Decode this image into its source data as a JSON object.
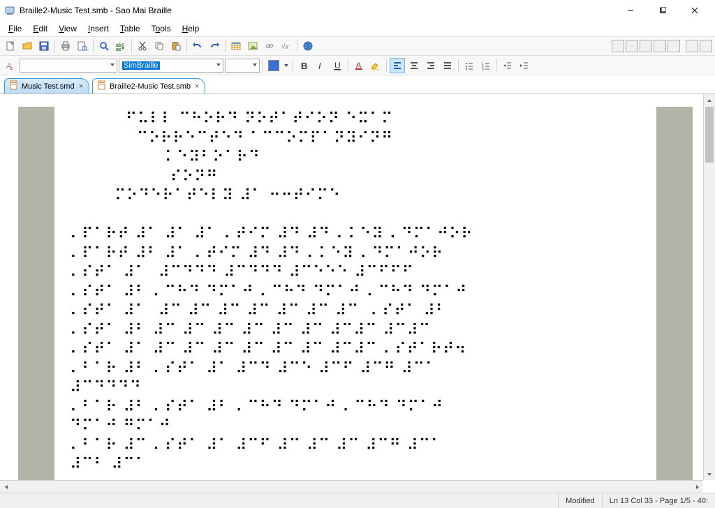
{
  "window": {
    "title": "Braille2-Music Test.smb - Sao Mai Braille"
  },
  "menu": {
    "file": "File",
    "edit": "Edit",
    "view": "View",
    "insert": "Insert",
    "table": "Table",
    "tools": "Tools",
    "help": "Help"
  },
  "toolbar": {
    "style_combo": "",
    "font_combo": "SimBraille",
    "size_combo": "",
    "color_swatch": "#3a6fd8"
  },
  "tabs": {
    "inactive": {
      "label": "Music Test.smd"
    },
    "active": {
      "label": "Braille2-Music Test.smb"
    }
  },
  "document": {
    "lines": [
      "          ⠋⠥⠇⠇ ⠉⠓⠕⠗⠙ ⠝⠕⠞⠁⠞⠊⠕⠝ ⠑⠭⠁⠍",
      "            ⠉⠕⠗⠗⠑⠉⠞⠑⠙ ⠁⠉⠉⠕⠍⠏⠁⠝⠽⠊⠝⠛",
      "                 ⠅⠑⠽⠃⠕⠁⠗⠙",
      "                  ⠎⠕⠝⠛",
      "        ⠍⠕⠙⠑⠗⠁⠞⠑⠇⠽ ⠼⠁ ⠒⠒⠞⠊⠍⠑",
      "",
      "⠄⠏⠁⠗⠞ ⠼⠁ ⠼⠁ ⠼⠁ ⠄⠞⠊⠍ ⠼⠙ ⠼⠙ ⠄⠅⠑⠽ ⠄⠙⠍⠁⠚⠕⠗",
      "⠄⠏⠁⠗⠞ ⠼⠃ ⠼⠁ ⠄⠞⠊⠍ ⠼⠙ ⠼⠙ ⠄⠅⠑⠽ ⠄⠙⠍⠁⠚⠕⠗",
      "⠄⠎⠞⠁ ⠼⠁  ⠼⠉⠙⠙⠙ ⠼⠉⠙⠙⠙ ⠼⠉⠑⠑⠑ ⠼⠉⠋⠋⠋",
      "⠄⠎⠞⠁ ⠼⠃ ⠄⠉⠓⠙ ⠙⠍⠁⠚ ⠄⠉⠓⠙ ⠙⠍⠁⠚ ⠄⠉⠓⠙ ⠙⠍⠁⠚",
      "⠄⠎⠞⠁ ⠼⠁  ⠼⠉ ⠼⠉ ⠼⠉ ⠼⠉ ⠼⠉ ⠼⠉ ⠼⠉  ⠄⠎⠞⠁ ⠼⠃",
      "⠄⠎⠞⠁ ⠼⠃ ⠼⠉ ⠼⠉ ⠼⠉ ⠼⠉ ⠼⠉ ⠼⠉ ⠼⠉⠼⠉ ⠼⠉⠼⠉",
      "⠄⠎⠞⠁ ⠼⠁ ⠼⠉ ⠼⠉ ⠼⠉ ⠼⠉ ⠼⠉ ⠼⠉ ⠼⠉⠼⠉ ⠄⠎⠞⠁⠗⠞⠲",
      "⠄⠃⠁⠗ ⠼⠃ ⠄⠎⠞⠁ ⠼⠁ ⠼⠉⠙ ⠼⠉⠑ ⠼⠉⠋ ⠼⠉⠛ ⠼⠉⠁",
      "⠼⠉⠙⠙⠙⠙",
      "⠄⠃⠁⠗ ⠼⠃ ⠄⠎⠞⠁ ⠼⠃ ⠄⠉⠓⠙ ⠙⠍⠁⠚ ⠄⠉⠓⠙ ⠙⠍⠁⠚",
      "⠙⠍⠁⠚ ⠛⠍⠁⠚",
      "⠄⠃⠁⠗ ⠼⠉ ⠄⠎⠞⠁ ⠼⠁ ⠼⠉⠋ ⠼⠉ ⠼⠉ ⠼⠉ ⠼⠉⠛ ⠼⠉⠁",
      "⠼⠉⠃ ⠼⠉⠁"
    ]
  },
  "status": {
    "modified": "Modified",
    "position": "Ln 13 Col 33 - Page 1/5 - 40:"
  }
}
